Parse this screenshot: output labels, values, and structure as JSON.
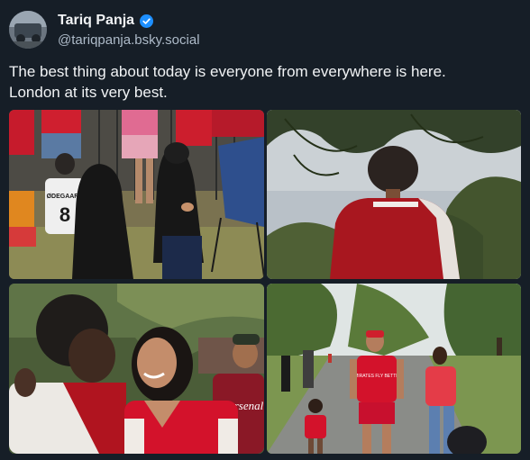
{
  "post": {
    "author": {
      "display_name": "Tariq Panja",
      "handle": "@tariqpanja.bsky.social",
      "verified_icon": "verified-badge-icon"
    },
    "text_lines": [
      "The best thing about today is everyone from everywhere is here.",
      "London at its very best."
    ],
    "images": [
      {
        "shirt_text": "ØDEGAARD",
        "shirt_number": "8"
      },
      {},
      {
        "shirt_text": "Arsenal"
      },
      {
        "shirt_text": "EMIRATES FLY BETTER"
      }
    ]
  },
  "colors": {
    "background": "#161e27",
    "text": "#f1f3f5",
    "secondary_text": "#aebbc9",
    "verified": "#1d8fff",
    "arsenal_red": "#d3122b"
  }
}
